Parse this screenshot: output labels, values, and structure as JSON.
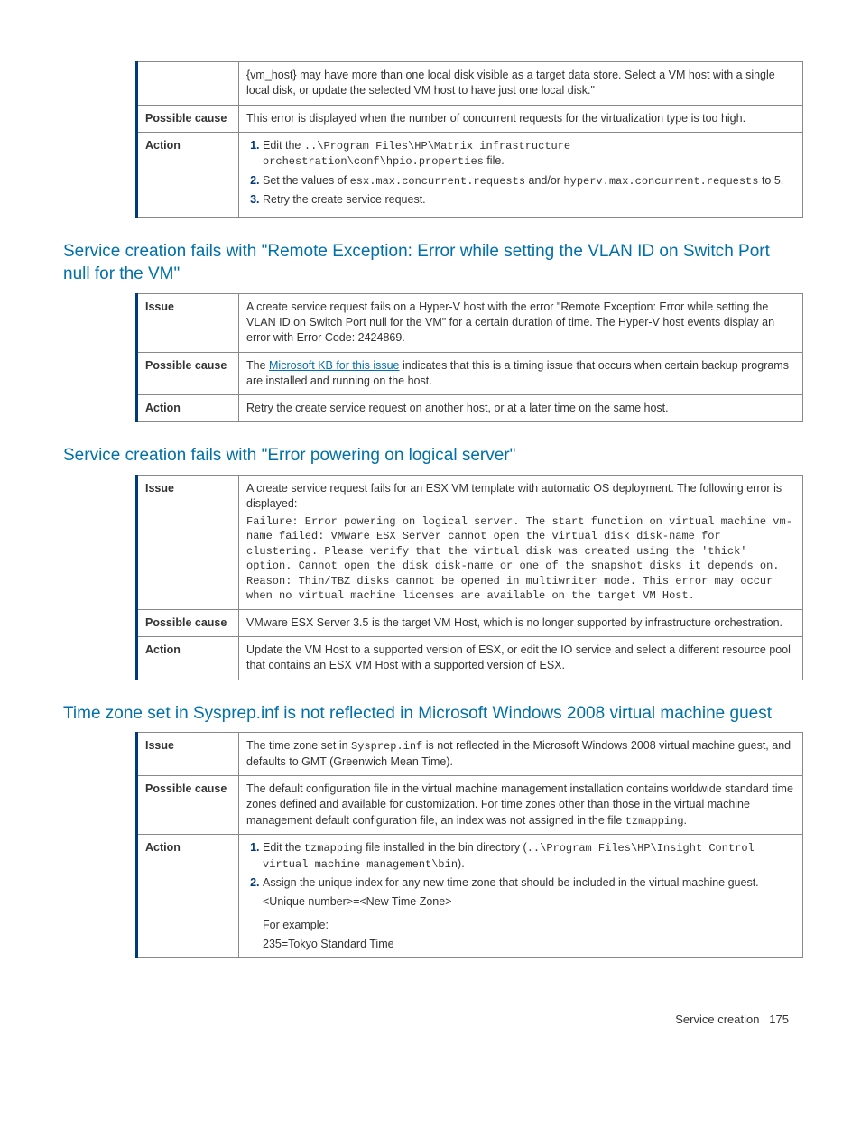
{
  "table1": {
    "row0_text": "{vm_host} may have more than one local disk visible as a target data store. Select a VM host with a single local disk, or update the selected VM host to have just one local disk.\"",
    "label_cause": "Possible cause",
    "cause_text": "This error is displayed when the number of concurrent requests for the virtualization type is too high.",
    "label_action": "Action",
    "action_li1_a": "Edit the ",
    "action_li1_code": "..\\Program Files\\HP\\Matrix infrastructure orchestration\\conf\\hpio.properties",
    "action_li1_b": " file.",
    "action_li2_a": "Set the values of ",
    "action_li2_code1": "esx.max.concurrent.requests",
    "action_li2_b": " and/or ",
    "action_li2_code2": "hyperv.max.concurrent.requests",
    "action_li2_c": " to 5.",
    "action_li3": "Retry the create service request."
  },
  "heading2": "Service creation fails with \"Remote Exception: Error while setting the VLAN ID on Switch Port null for the VM\"",
  "table2": {
    "label_issue": "Issue",
    "issue_text": "A create service request fails on a Hyper-V host with the error \"Remote Exception: Error while setting the VLAN ID on Switch Port null for the VM\" for a certain duration of time. The Hyper-V host events display an error with Error Code: 2424869.",
    "label_cause": "Possible cause",
    "cause_a": "The ",
    "cause_link": "Microsoft KB for this issue",
    "cause_b": " indicates that this is a timing issue that occurs when certain backup programs are installed and running on the host.",
    "label_action": "Action",
    "action_text": "Retry the create service request on another host, or at a later time on the same host."
  },
  "heading3": "Service creation fails with \"Error powering on logical server\"",
  "table3": {
    "label_issue": "Issue",
    "issue_intro": "A create service request fails for an ESX VM template with automatic OS deployment. The following error is displayed:",
    "issue_code": "Failure: Error powering on logical server. The start function on virtual machine vm-name failed: VMware ESX Server cannot open the virtual disk disk-name for clustering. Please verify that the virtual disk was created using the 'thick' option. Cannot open the disk disk-name or one of the snapshot disks it depends on. Reason: Thin/TBZ disks cannot be opened in multiwriter mode. This error may occur when no virtual machine licenses are available on the target VM Host.",
    "label_cause": "Possible cause",
    "cause_text": "VMware ESX Server 3.5 is the target VM Host, which is no longer supported by infrastructure orchestration.",
    "label_action": "Action",
    "action_text": "Update the VM Host to a supported version of ESX, or edit the IO service and select a different resource pool that contains an ESX VM Host with a supported version of ESX."
  },
  "heading4": "Time zone set in Sysprep.inf is not reflected in Microsoft Windows 2008 virtual machine guest",
  "table4": {
    "label_issue": "Issue",
    "issue_a": "The time zone set in ",
    "issue_code": "Sysprep.inf",
    "issue_b": " is not reflected in the Microsoft Windows 2008 virtual machine guest, and defaults to GMT (Greenwich Mean Time).",
    "label_cause": "Possible cause",
    "cause_a": "The default configuration file in the virtual machine management installation contains worldwide standard time zones defined and available for customization. For time zones other than those in the virtual machine management default configuration file, an index was not assigned in the file ",
    "cause_code": "tzmapping",
    "cause_b": ".",
    "label_action": "Action",
    "action_li1_a": "Edit the ",
    "action_li1_code1": "tzmapping",
    "action_li1_b": " file installed in the bin directory (",
    "action_li1_code2": "..\\Program Files\\HP\\Insight Control virtual machine management\\bin",
    "action_li1_c": ").",
    "action_li2": "Assign the unique index for any new time zone that should be included in the virtual machine guest.",
    "action_sub1": "<Unique number>=<New Time Zone>",
    "action_sub2": "For example:",
    "action_sub3": "235=Tokyo Standard Time"
  },
  "footer": {
    "section": "Service creation",
    "page": "175"
  }
}
